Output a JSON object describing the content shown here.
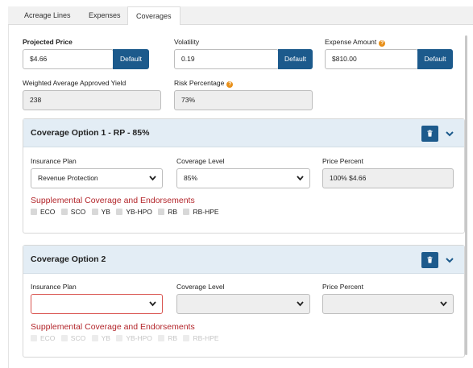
{
  "tabs": [
    {
      "label": "Acreage Lines",
      "active": false
    },
    {
      "label": "Expenses",
      "active": false
    },
    {
      "label": "Coverages",
      "active": true
    }
  ],
  "top_fields": {
    "projected_price": {
      "label": "Projected Price",
      "value": "$4.66",
      "button": "Default"
    },
    "volatility": {
      "label": "Volatility",
      "value": "0.19",
      "button": "Default"
    },
    "expense_amount": {
      "label": "Expense Amount",
      "value": "$810.00",
      "button": "Default"
    },
    "weighted_yield": {
      "label": "Weighted Average Approved Yield",
      "value": "238"
    },
    "risk_percentage": {
      "label": "Risk Percentage",
      "value": "73%"
    }
  },
  "help_glyph": "?",
  "coverage_options": [
    {
      "title": "Coverage Option 1 - RP - 85%",
      "insurance_plan": {
        "label": "Insurance Plan",
        "value": "Revenue Protection"
      },
      "coverage_level": {
        "label": "Coverage Level",
        "value": "85%"
      },
      "price_percent": {
        "label": "Price Percent",
        "value": "100% $4.66"
      },
      "supplemental_title": "Supplemental Coverage and Endorsements",
      "endorsements": [
        "ECO",
        "SCO",
        "YB",
        "YB-HPO",
        "RB",
        "RB-HPE"
      ]
    },
    {
      "title": "Coverage Option 2",
      "insurance_plan": {
        "label": "Insurance Plan",
        "value": ""
      },
      "coverage_level": {
        "label": "Coverage Level",
        "value": ""
      },
      "price_percent": {
        "label": "Price Percent",
        "value": ""
      },
      "supplemental_title": "Supplemental Coverage and Endorsements",
      "endorsements": [
        "ECO",
        "SCO",
        "YB",
        "YB-HPO",
        "RB",
        "RB-HPE"
      ]
    }
  ],
  "icons": {
    "help": "question-circle-icon",
    "delete": "trash-icon",
    "collapse": "chevron-down-icon",
    "dropdown": "caret-down-icon"
  },
  "colors": {
    "primary": "#1c5a8c",
    "card_header": "#e3edf5",
    "supplemental": "#b3262b",
    "help": "#e8901a",
    "invalid": "#d9534f"
  }
}
